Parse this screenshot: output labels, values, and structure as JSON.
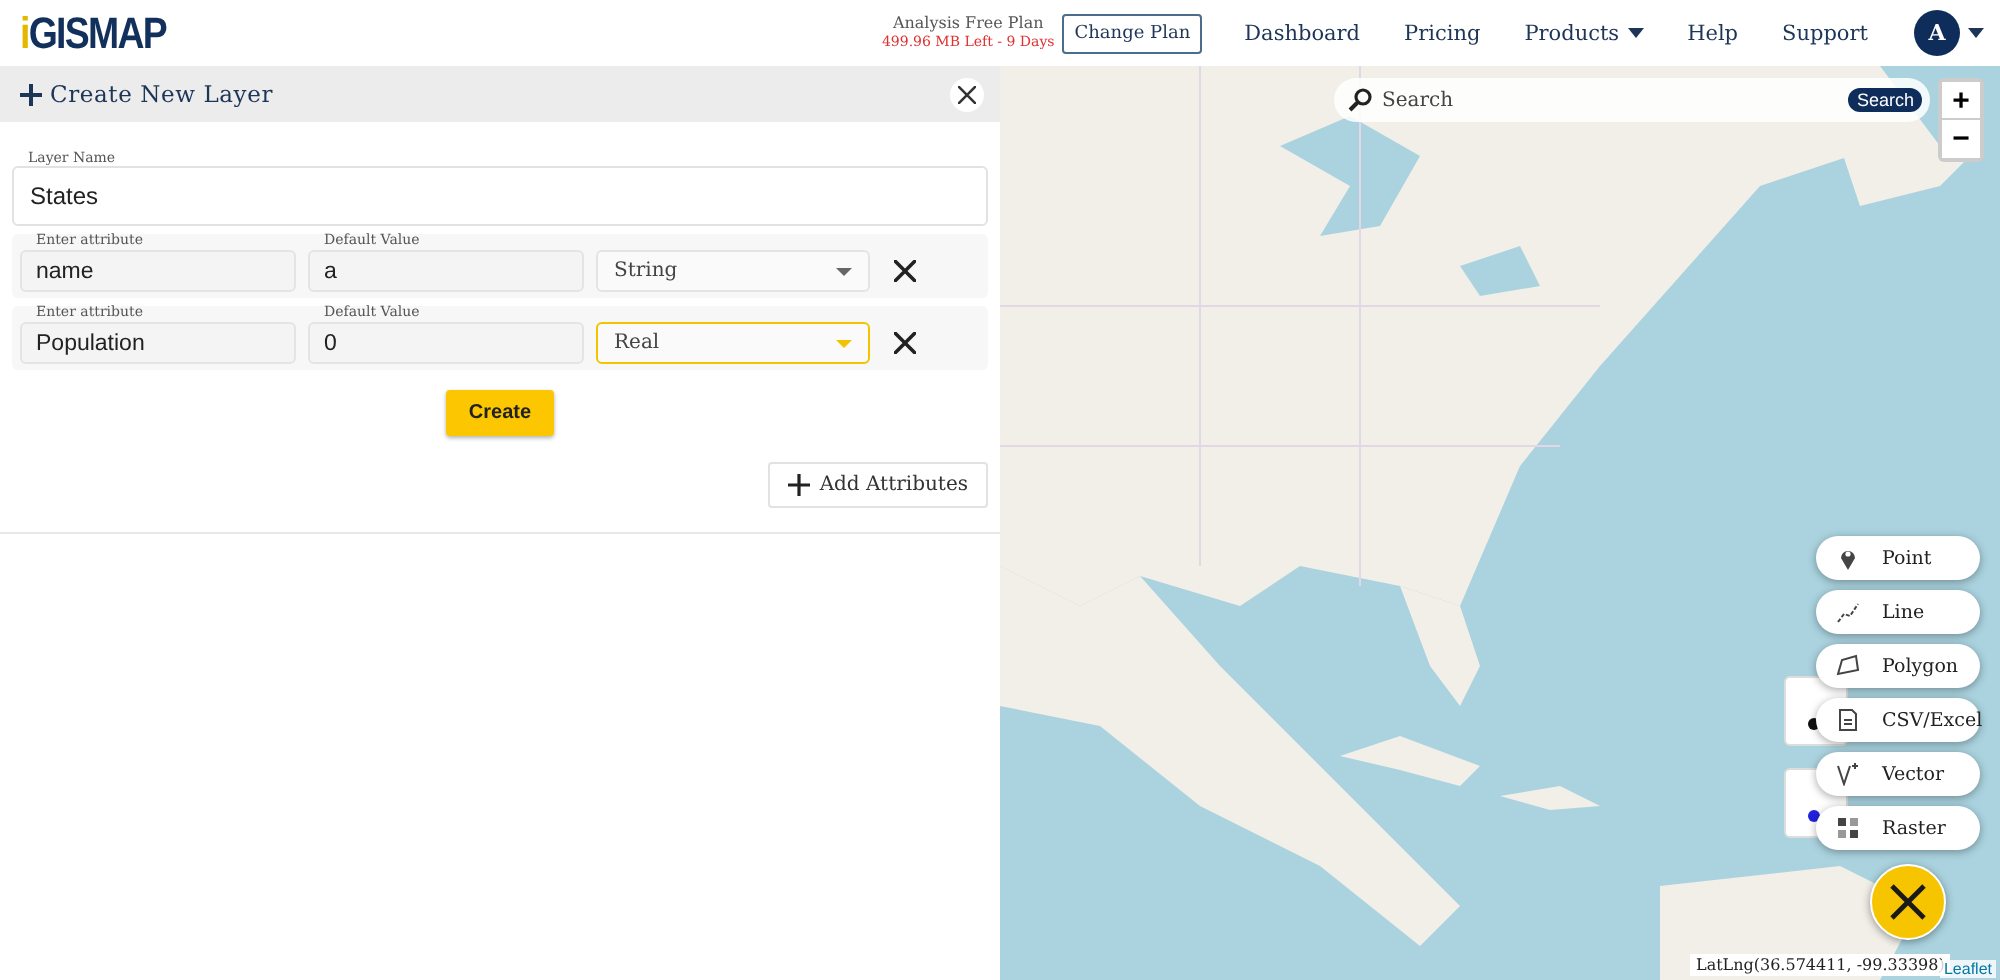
{
  "header": {
    "logo": "iGISMAP",
    "plan": {
      "title": "Analysis Free Plan",
      "usage": "499.96 MB Left - 9 Days"
    },
    "change_plan": "Change Plan",
    "nav": [
      {
        "label": "Dashboard",
        "dropdown": false
      },
      {
        "label": "Pricing",
        "dropdown": false
      },
      {
        "label": "Products",
        "dropdown": true
      },
      {
        "label": "Help",
        "dropdown": false
      },
      {
        "label": "Support",
        "dropdown": false
      }
    ],
    "avatar": "A"
  },
  "panel": {
    "title": "Create New Layer",
    "layer_name": {
      "label": "Layer Name",
      "value": "States"
    },
    "attributes": [
      {
        "attr_label": "Enter attribute",
        "attr_value": "name",
        "default_label": "Default Value",
        "default_value": "a",
        "type": "String",
        "focused": false
      },
      {
        "attr_label": "Enter attribute",
        "attr_value": "Population",
        "default_label": "Default Value",
        "default_value": "0",
        "type": "Real",
        "focused": true
      }
    ],
    "create": "Create",
    "add": "Add Attributes"
  },
  "map": {
    "search": {
      "placeholder": "Search",
      "button": "Search"
    },
    "zoom_in": "+",
    "zoom_out": "−",
    "legends": [
      {
        "color": "#111111"
      },
      {
        "color": "#2222dd"
      }
    ],
    "add_menu": [
      {
        "kind": "point",
        "label": "Point"
      },
      {
        "kind": "line",
        "label": "Line"
      },
      {
        "kind": "polygon",
        "label": "Polygon"
      },
      {
        "kind": "csv",
        "label": "CSV/Excel"
      },
      {
        "kind": "vector",
        "label": "Vector"
      },
      {
        "kind": "raster",
        "label": "Raster"
      }
    ],
    "latlng": "LatLng(36.574411, -99.33398)",
    "attribution": "Leaflet"
  }
}
